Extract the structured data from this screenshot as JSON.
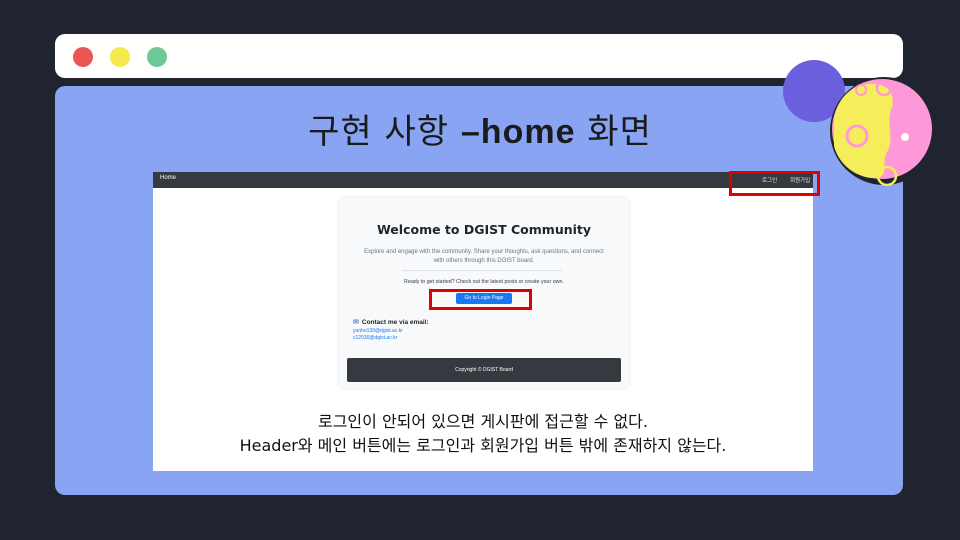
{
  "slide": {
    "title_ko": "구현 사항 ",
    "title_en": "–home",
    "title_ko2": " 화면",
    "caption_line1": "로그인이 안되어 있으면 게시판에 접근할 수 없다.",
    "caption_line2": "Header와 메인 버튼에는 로그인과 회원가입 버튼 밖에 존재하지 않는다."
  },
  "app": {
    "navbar": {
      "brand": "Home",
      "login_label": "로그인",
      "signup_label": "회원가입"
    },
    "card": {
      "title": "Welcome to DGIST Community",
      "description": "Explore and engage with the community. Share your thoughts, ask questions, and connect with others through this DGIST board.",
      "ready_text": "Ready to get started? Check out the latest posts or create your own.",
      "login_button": "Go to Login Page",
      "contact_title": "Contact me via email:",
      "emails": [
        "yunho139@dgist.ac.kr",
        "c12030@dgist.ac.kr"
      ],
      "footer": "Copyright © DGIST Board"
    }
  },
  "colors": {
    "background": "#1f2430",
    "slide": "#88a4f3",
    "highlight": "#e00000",
    "button": "#1877f2",
    "navbar": "#343a40"
  },
  "icons": [
    "window-close-dot-icon",
    "window-minimize-dot-icon",
    "window-maximize-dot-icon",
    "contact-icon"
  ]
}
